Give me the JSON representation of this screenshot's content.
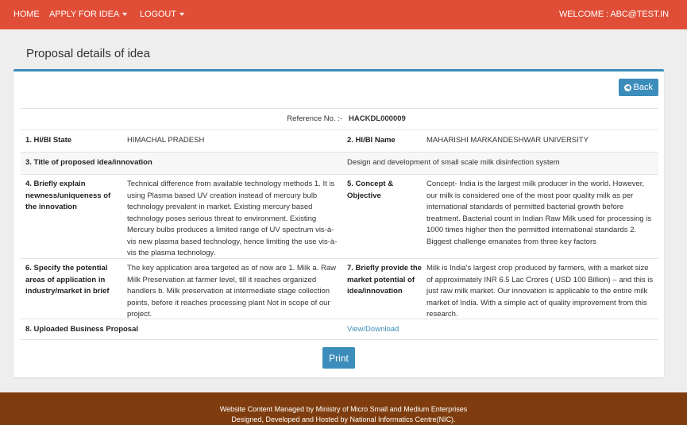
{
  "nav": {
    "home": "HOME",
    "apply": "APPLY FOR IDEA",
    "logout": "LOGOUT",
    "welcome": "WELCOME : ABC@TEST.IN"
  },
  "page": {
    "title": "Proposal details of idea",
    "back": "Back",
    "print": "Print"
  },
  "reference": {
    "label": "Reference No. :-",
    "value": "HACKDL000009"
  },
  "details": {
    "state_label": "1. HI/BI State",
    "state_value": "HIMACHAL PRADESH",
    "name_label": "2. HI/BI Name",
    "name_value": "MAHARISHI MARKANDESHWAR UNIVERSITY",
    "title_label": "3. Title of proposed idea/innovation",
    "title_value": "Design and development of small scale milk disinfection system",
    "newness_label": "4. Briefly explain newness/uniqueness of the innovation",
    "newness_value": "Technical difference from available technology methods 1. It is using Plasma based UV creation instead of mercury bulb technology prevalent in market. Existing mercury based technology poses serious threat to environment. Existing Mercury bulbs produces a limited range of UV spectrum vis-à-vis new plasma based technology, hence limiting the use vis-à-vis the plasma technology.",
    "concept_label": "5. Concept & Objective",
    "concept_value": "Concept- India is the largest milk producer in the world. However, our milk is considered one of the most poor quality milk as per international standards of permitted bacterial growth before treatment. Bacterial count in Indian Raw Milk used for processing is 1000 times higher then the permitted international standards 2. Biggest challenge emanates from three key factors",
    "application_label": "6. Specify the potential areas of application in industry/market in brief",
    "application_value": "The key application area targeted as of now are 1. Milk a. Raw Milk Preservation at farmer level, till it reaches organized handlers b. Milk preservation at intermediate stage collection points, before it reaches processing plant Not in scope of our project.",
    "market_label": "7. Briefly provide the market potential of idea/innovation",
    "market_value": "Milk is India's largest crop produced by farmers, with a market size of approximately INR 6.5 Lac Crores ( USD 100 Billion) – and this is just raw milk market. Our innovation is applicable to the entire milk market of India. With a simple act of quality improvement from this research.",
    "upload_label": "8. Uploaded Business Proposal",
    "upload_link": "View/Download"
  },
  "footer": {
    "line1": "Website Content Managed by Ministry of Micro Small and Medium Enterprises",
    "line2": "Designed, Developed and Hosted by National Informatics Centre(NIC)."
  },
  "colors": {
    "navbar": "#e04e37",
    "accent": "#3c8dbc",
    "footer": "#7f3d0f"
  }
}
